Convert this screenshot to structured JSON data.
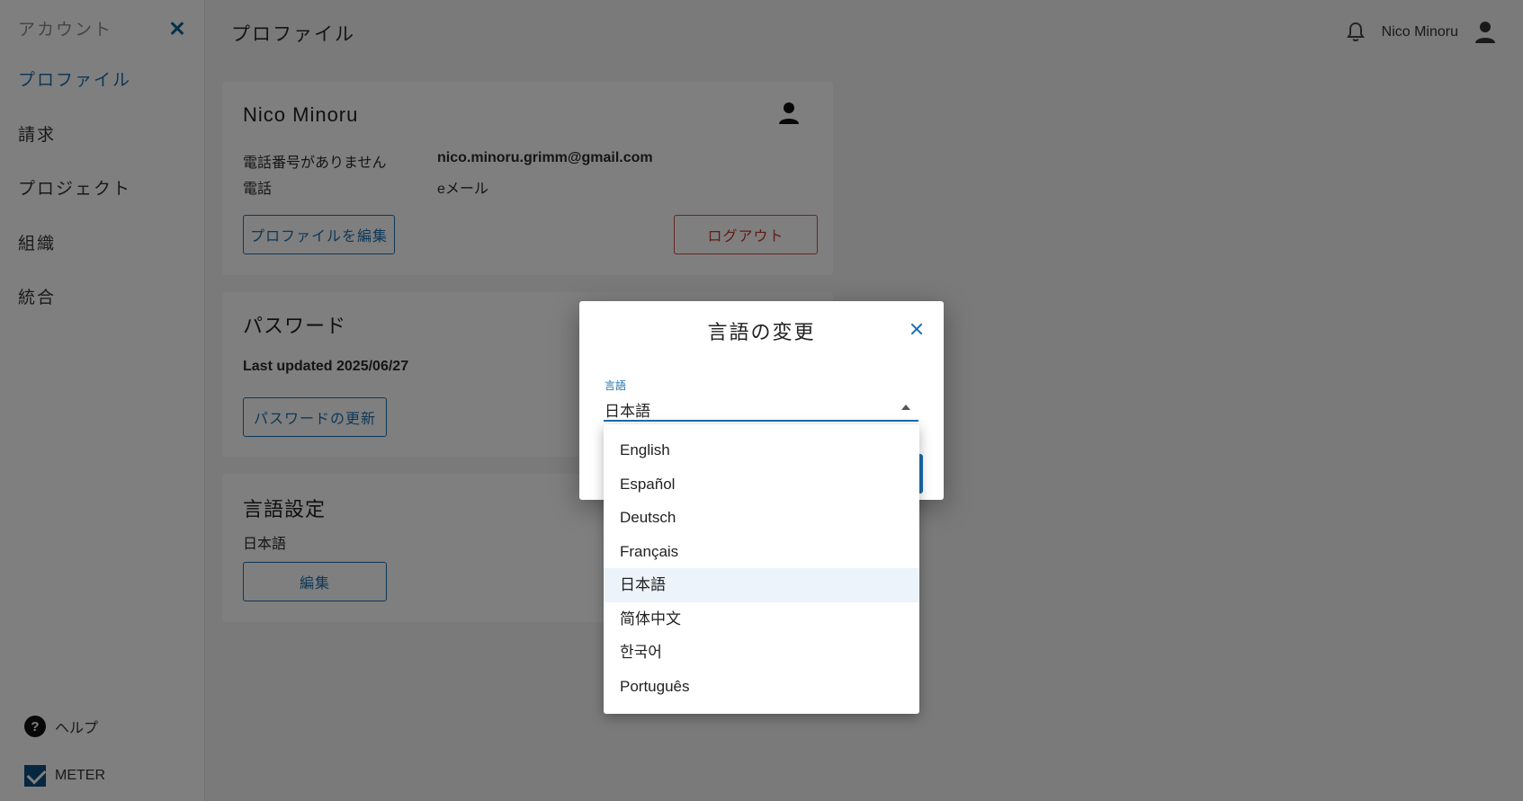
{
  "sidebar": {
    "title": "アカウント",
    "items": [
      {
        "label": "プロファイル"
      },
      {
        "label": "請求"
      },
      {
        "label": "プロジェクト"
      },
      {
        "label": "組織"
      },
      {
        "label": "統合"
      }
    ],
    "help_label": "ヘルプ",
    "brand_label": "METER"
  },
  "header": {
    "title": "プロファイル",
    "user_name": "Nico Minoru"
  },
  "profile": {
    "name": "Nico Minoru",
    "phone_value": "電話番号がありません",
    "phone_label": "電話",
    "email_value": "nico.minoru.grimm@gmail.com",
    "email_label": "eメール",
    "edit_button": "プロファイルを編集",
    "logout_button": "ログアウト"
  },
  "password": {
    "title": "パスワード",
    "last_updated": "Last updated 2025/06/27",
    "update_button": "パスワードの更新"
  },
  "language_settings": {
    "title": "言語設定",
    "current": "日本語",
    "edit_button": "編集"
  },
  "dialog": {
    "title": "言語の変更",
    "field_label": "言語",
    "selected_value": "日本語",
    "options": [
      "English",
      "Español",
      "Deutsch",
      "Français",
      "日本語",
      "简体中文",
      "한국어",
      "Português"
    ],
    "selected_index": 4
  },
  "colors": {
    "accent": "#1a6fb0",
    "danger": "#c0392b",
    "brand": "#0b4f7e"
  }
}
